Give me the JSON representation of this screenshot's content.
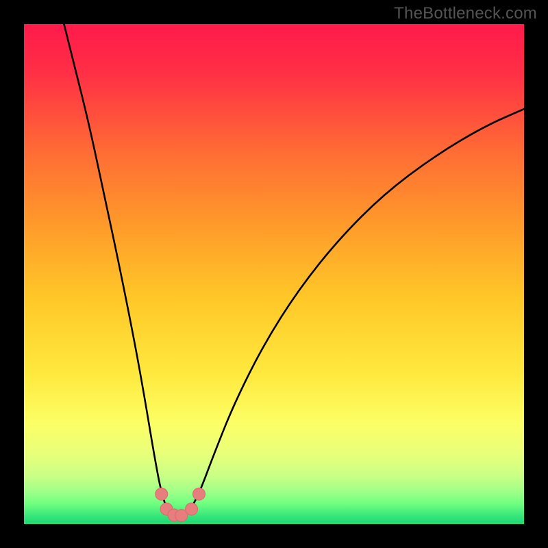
{
  "watermark": "TheBottleneck.com",
  "colors": {
    "frame": "#000000",
    "gradient_stops": [
      {
        "offset": 0.0,
        "color": "#ff1a4b"
      },
      {
        "offset": 0.1,
        "color": "#ff3045"
      },
      {
        "offset": 0.25,
        "color": "#ff6a35"
      },
      {
        "offset": 0.4,
        "color": "#ff9a2a"
      },
      {
        "offset": 0.55,
        "color": "#ffc828"
      },
      {
        "offset": 0.7,
        "color": "#ffe93e"
      },
      {
        "offset": 0.8,
        "color": "#fcff66"
      },
      {
        "offset": 0.86,
        "color": "#e8ff7a"
      },
      {
        "offset": 0.905,
        "color": "#c8ff86"
      },
      {
        "offset": 0.935,
        "color": "#9fff88"
      },
      {
        "offset": 0.96,
        "color": "#6eff80"
      },
      {
        "offset": 0.985,
        "color": "#33e57a"
      },
      {
        "offset": 1.0,
        "color": "#1fd873"
      }
    ],
    "curve": "#000000",
    "marker_fill": "#e77d7d",
    "marker_stroke": "#db6a6a"
  },
  "chart_data": {
    "type": "line",
    "title": "",
    "xlabel": "",
    "ylabel": "",
    "xlim": [
      0,
      100
    ],
    "ylim": [
      0,
      100
    ],
    "note": "x and y are normalized percentages of the plot area; y=0 is bottom (green), y=100 is top (red). Curve is a V-shaped bottleneck profile with minimum near x≈30.",
    "series": [
      {
        "name": "bottleneck-curve",
        "points": [
          {
            "x": 8.0,
            "y": 100.0
          },
          {
            "x": 10.0,
            "y": 92.0
          },
          {
            "x": 13.0,
            "y": 80.0
          },
          {
            "x": 16.0,
            "y": 66.0
          },
          {
            "x": 19.0,
            "y": 52.0
          },
          {
            "x": 22.0,
            "y": 37.0
          },
          {
            "x": 24.0,
            "y": 26.0
          },
          {
            "x": 26.0,
            "y": 14.0
          },
          {
            "x": 27.5,
            "y": 6.0
          },
          {
            "x": 29.0,
            "y": 2.0
          },
          {
            "x": 31.0,
            "y": 1.5
          },
          {
            "x": 33.0,
            "y": 2.5
          },
          {
            "x": 35.0,
            "y": 6.0
          },
          {
            "x": 38.0,
            "y": 14.0
          },
          {
            "x": 42.0,
            "y": 24.0
          },
          {
            "x": 48.0,
            "y": 36.0
          },
          {
            "x": 55.0,
            "y": 47.0
          },
          {
            "x": 63.0,
            "y": 57.0
          },
          {
            "x": 72.0,
            "y": 66.0
          },
          {
            "x": 82.0,
            "y": 73.5
          },
          {
            "x": 92.0,
            "y": 79.5
          },
          {
            "x": 100.0,
            "y": 83.0
          }
        ]
      }
    ],
    "markers": [
      {
        "x": 27.5,
        "y": 6.0
      },
      {
        "x": 28.5,
        "y": 3.0
      },
      {
        "x": 30.0,
        "y": 1.8
      },
      {
        "x": 31.5,
        "y": 1.7
      },
      {
        "x": 33.5,
        "y": 3.0
      },
      {
        "x": 35.0,
        "y": 6.0
      }
    ]
  }
}
